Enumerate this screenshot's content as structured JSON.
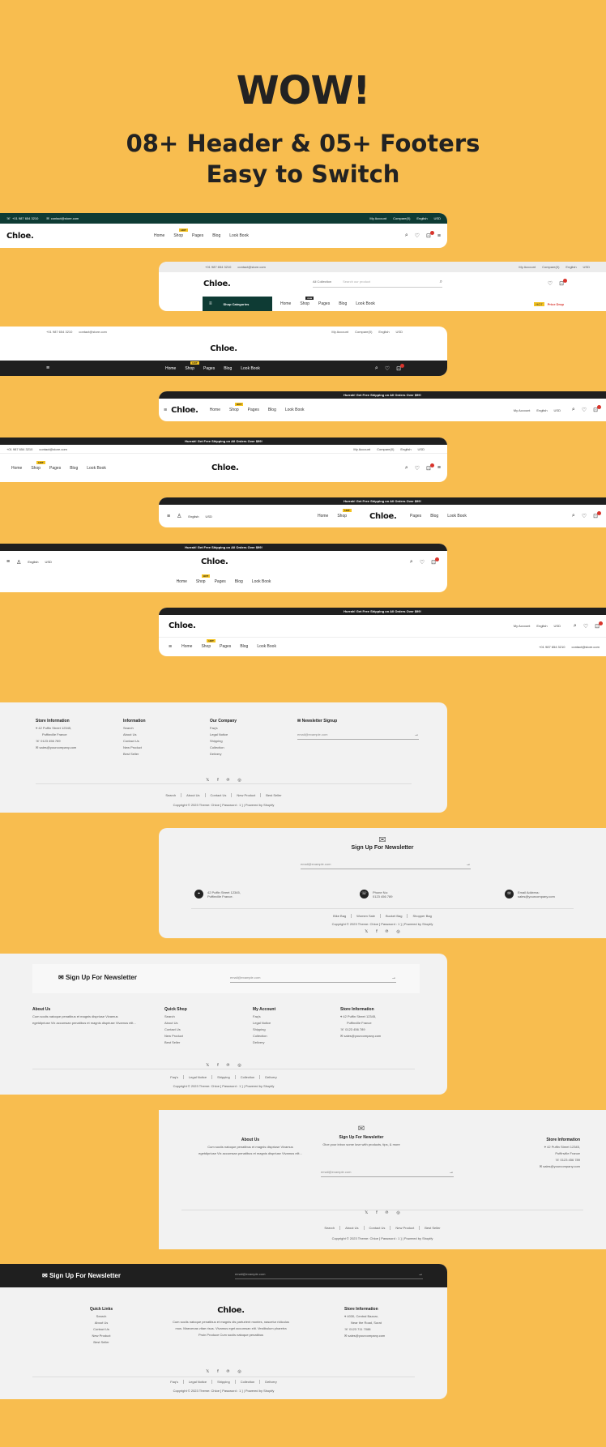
{
  "hero": {
    "title": "WOW!",
    "line1": "08+ Header &  05+ Footers",
    "line2": "Easy to Switch"
  },
  "logo": "Chloe.",
  "icons": [
    "search-icon",
    "heart-icon",
    "cart-icon",
    "menu-icon",
    "user-icon",
    "mail-icon",
    "phone-icon",
    "location-icon",
    "arrow-right-icon"
  ],
  "colors": {
    "background": "#f8bd4f",
    "dark": "#1f1f1f",
    "green": "#0e3b34",
    "badge": "#f4c21f",
    "cart_dot": "#d8342c"
  },
  "common": {
    "phone": "+01 987 654 3210",
    "email": "contact@store.com",
    "my_account": "My Account",
    "compare": "Compare(0)",
    "english": "English",
    "usd": "USD",
    "hot": "HOT",
    "promo": "Hurrah! Get Free Shipping on All Orders Over $99!",
    "search_icon": "⌕",
    "heart_icon": "♡",
    "cart_icon": "⊡",
    "menu_icon": "≡",
    "user_icon": "♙"
  },
  "nav": {
    "home": "Home",
    "shop": "Shop",
    "pages": "Pages",
    "blog": "Blog",
    "lookbook": "Look Book"
  },
  "header2": {
    "collection": "All Collection",
    "search_placeholder": "Search our product",
    "shop_categories": "Shop Categories",
    "new": "new",
    "price_drop": "Price Drop"
  },
  "f1": {
    "store": "Store Information",
    "address1": "42 Puffin Street 12345,",
    "address2": "Puffinville France",
    "phone": "0123 456 789",
    "email": "sales@yourcompany.com",
    "info": "Information",
    "info_links": [
      "Search",
      "About Us",
      "Contact Us",
      "New Product",
      "Best Seller"
    ],
    "company": "Our Company",
    "company_links": [
      "Faq's",
      "Legal Notice",
      "Shipping",
      "Collection",
      "Delivery"
    ],
    "news": "Newsletter Signup",
    "email_ph": "email@example.com",
    "bottom": [
      "Search",
      "About Us",
      "Contact Us",
      "New Product",
      "Best Seller"
    ],
    "copyright": "Copyright © 2023 Theme: Chloe [ Password : 1 ] | Powered by Shopify",
    "social": [
      "𝕏",
      "f",
      "℗",
      "◎"
    ]
  },
  "f2": {
    "title": "Sign Up For Newsletter",
    "email_ph": "email@example.com",
    "addr_a": "42 Puffin Street 12345,",
    "addr_b": "Puffinville France.",
    "phone_label": "Phone No:",
    "phone": "0123 456 789",
    "mail_label": "Email Address:",
    "mail": "sales@yourcompany.com",
    "links": [
      "Bike Bag",
      "Women Sale",
      "Bucket Bag",
      "Shopper Bag"
    ],
    "copyright": "Copyright © 2023 Theme: Chloe [ Password : 1 ] | Powered by Shopify"
  },
  "f3": {
    "title": "Sign Up For Newsletter",
    "email_ph": "email@example.com",
    "about": "About Us",
    "about_text1": "Cum sociis natoque penatibus et magnis dispriuse Vivamus",
    "about_text2": "egetdipriuse Vix accumsan penatibus et magnis dispriuse Vivamus elit...",
    "quick": "Quick Shop",
    "quick_links": [
      "Search",
      "About Us",
      "Contact Us",
      "New Product",
      "Best Seller"
    ],
    "account": "My Account",
    "account_links": [
      "Faq's",
      "Legal Notice",
      "Shipping",
      "Collection",
      "Delivery"
    ],
    "store": "Store Information",
    "address1": "42 Puffin Street 12345,",
    "address2": "Puffinville France",
    "phone": "0123 456 789",
    "email": "sales@yourcompany.com",
    "bottom": [
      "Faq's",
      "Legal Notice",
      "Shipping",
      "Collection",
      "Delivery"
    ],
    "copyright": "Copyright © 2023 Theme: Chloe [ Password : 1 ] | Powered by Shopify"
  },
  "f4": {
    "about": "About Us",
    "about_text1": "Cum sociis natoque penatibus et magnis dispriuse Vivamus",
    "about_text2": "egetdipriuse Vix accumsan penatibus et magnis dispriuse Vivamus elit...",
    "news": "Sign Up For Newsletter",
    "tagline": "Give your inbox some love with products, tips, & more",
    "email_ph": "email@example.com",
    "store": "Store Information",
    "address1": "42 Puffin Street 12345,",
    "address2": "Puffinville France",
    "phone": "0123 456 789",
    "email": "sales@yourcompany.com",
    "bottom": [
      "Search",
      "About Us",
      "Contact Us",
      "New Product",
      "Best Seller"
    ],
    "copyright": "Copyright © 2023 Theme: Chloe [ Password : 1 ] | Powered by Shopify"
  },
  "f5": {
    "title": "Sign Up For Newsletter",
    "email_ph": "email@example.com",
    "quick": "Quick Links",
    "quick_links": [
      "Search",
      "About Us",
      "Contact Us",
      "New Product",
      "Best Seller"
    ],
    "text1": "Cum sociis natoque penatibus et magnis dis parturient montes, nascetur ridiculus",
    "text2": "mus. Maecenas vitae risus. Vivamus eget accumsan elit. Vestibulum pharetra",
    "text3": "Proin Produce Cum sociis natoque penatibus",
    "store": "Store Information",
    "address1": "4030, Central Bazzar,",
    "address2": "Near the Road, Surat",
    "phone": "0123 711 7088",
    "email": "sales@yourcompany.com",
    "bottom": [
      "Faq's",
      "Legal Notice",
      "Shipping",
      "Collection",
      "Delivery"
    ],
    "copyright": "Copyright © 2023 Theme: Chloe [ Password : 1 ] | Powered by Shopify"
  }
}
